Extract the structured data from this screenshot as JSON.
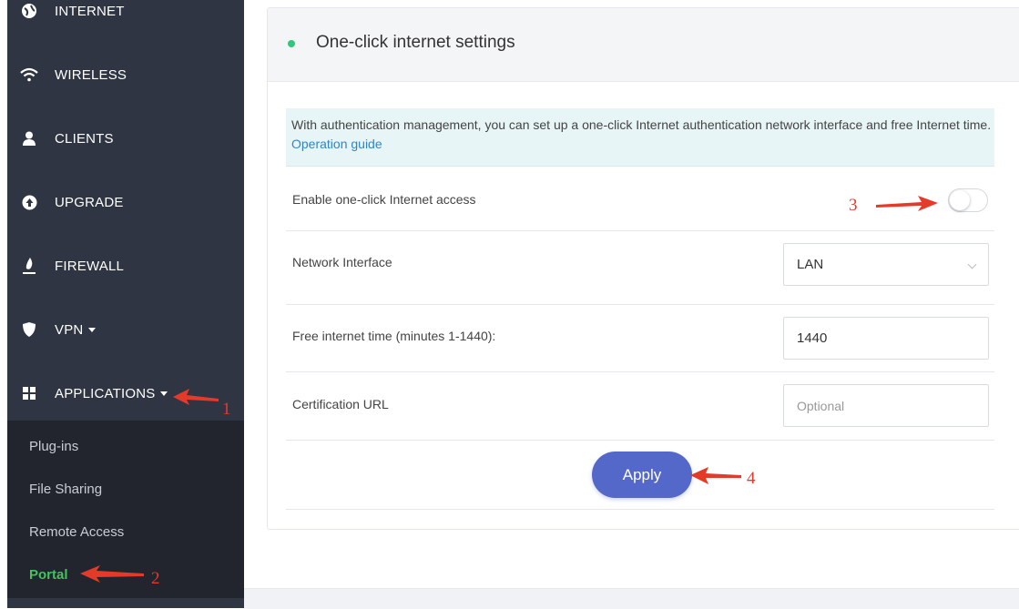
{
  "sidebar": {
    "items": [
      {
        "label": "INTERNET",
        "icon": "globe-icon"
      },
      {
        "label": "WIRELESS",
        "icon": "wifi-icon"
      },
      {
        "label": "CLIENTS",
        "icon": "user-icon"
      },
      {
        "label": "UPGRADE",
        "icon": "upload-icon"
      },
      {
        "label": "FIREWALL",
        "icon": "flame-icon"
      },
      {
        "label": "VPN",
        "icon": "shield-icon"
      },
      {
        "label": "APPLICATIONS",
        "icon": "grid-icon"
      }
    ],
    "submenu": [
      "Plug-ins",
      "File Sharing",
      "Remote Access",
      "Portal"
    ],
    "active_submenu": "Portal"
  },
  "main": {
    "title": "One-click internet settings",
    "notice": {
      "text": "With authentication management, you can set up a one-click Internet authentication network interface and free Internet time.",
      "link": "Operation guide"
    },
    "fields": {
      "enable_label": "Enable one-click Internet access",
      "enable_value": false,
      "interface_label": "Network Interface",
      "interface_value": "LAN",
      "free_time_label": "Free internet time (minutes 1-1440):",
      "free_time_value": "1440",
      "cert_url_label": "Certification URL",
      "cert_url_placeholder": "Optional"
    },
    "apply_label": "Apply"
  },
  "annotations": [
    "1",
    "2",
    "3",
    "4"
  ],
  "colors": {
    "sidebar": "#2f3542",
    "submenu": "#22252e",
    "active": "#43c35e",
    "button": "#5468c9",
    "arrow": "#e53a2a",
    "status_dot": "#34c77b"
  }
}
